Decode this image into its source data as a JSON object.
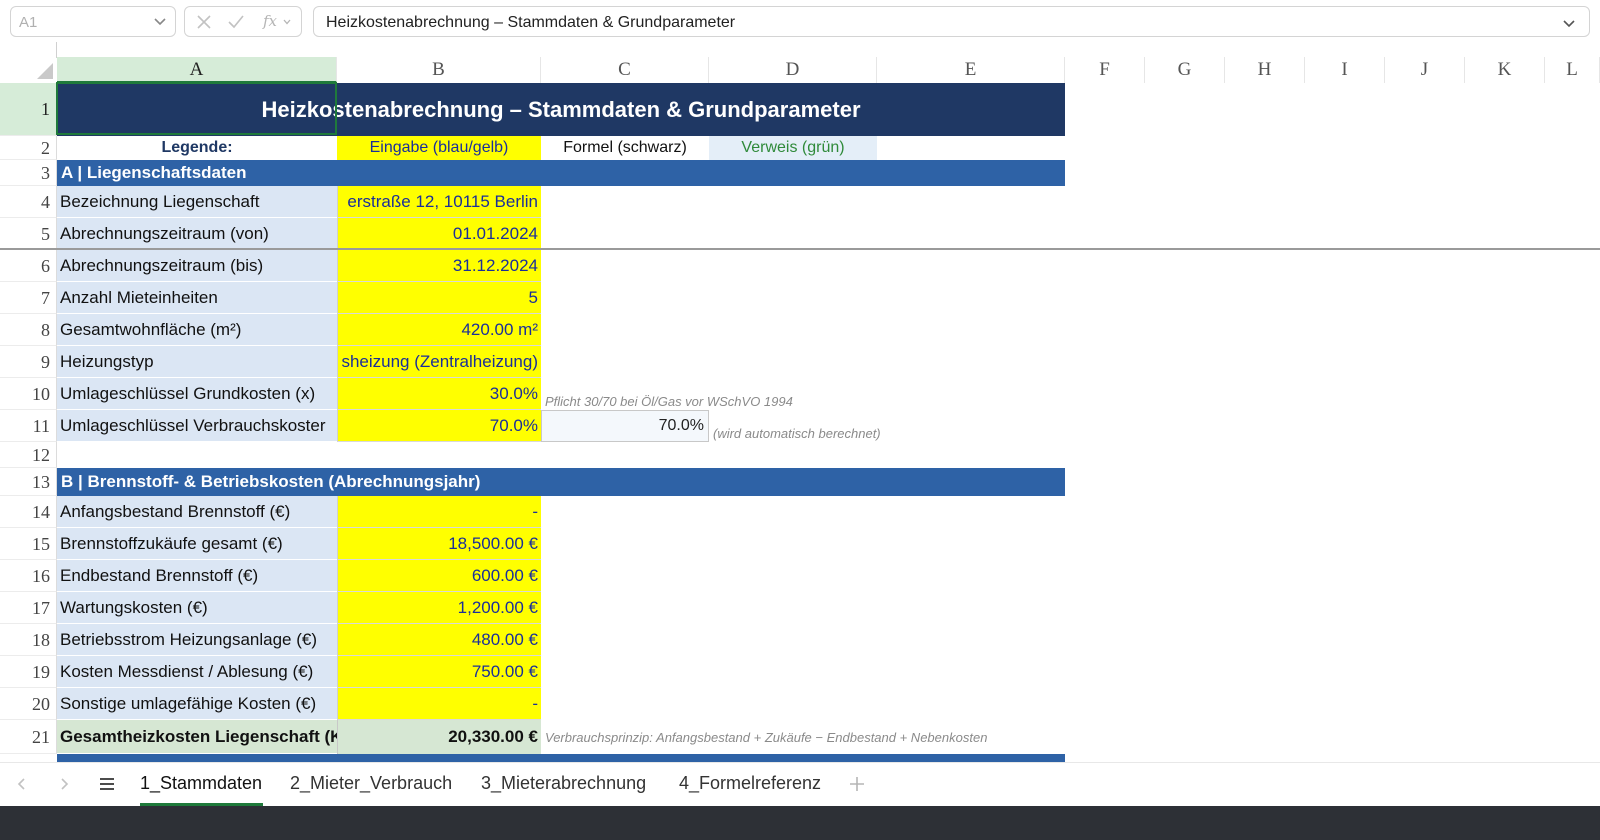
{
  "formula_bar": {
    "name_box": "A1",
    "fx_label": "fx",
    "formula_text": "Heizkostenabrechnung – Stammdaten & Grundparameter"
  },
  "columns": [
    "A",
    "B",
    "C",
    "D",
    "E",
    "F",
    "G",
    "H",
    "I",
    "J",
    "K",
    "L"
  ],
  "rows": [
    "1",
    "2",
    "3",
    "4",
    "5",
    "6",
    "7",
    "8",
    "9",
    "10",
    "11",
    "12",
    "13",
    "14",
    "15",
    "16",
    "17",
    "18",
    "19",
    "20",
    "21"
  ],
  "sheet": {
    "title": "Heizkostenabrechnung – Stammdaten & Grundparameter",
    "legend": {
      "label": "Legende:",
      "input": "Eingabe (blau/gelb)",
      "formula": "Formel (schwarz)",
      "reference": "Verweis (grün)"
    },
    "section_a": "A  |  Liegenschaftsdaten",
    "section_b": "B  |  Brennstoff- & Betriebskosten  (Abrechnungsjahr)",
    "rows_a": [
      {
        "label": "Bezeichnung Liegenschaft",
        "value": "erstraße 12, 10115 Berlin"
      },
      {
        "label": "Abrechnungszeitraum (von)",
        "value": "01.01.2024"
      },
      {
        "label": "Abrechnungszeitraum (bis)",
        "value": "31.12.2024"
      },
      {
        "label": "Anzahl Mieteinheiten",
        "value": "5"
      },
      {
        "label": "Gesamtwohnfläche (m²)",
        "value": "420.00 m²"
      },
      {
        "label": "Heizungstyp",
        "value": "sheizung (Zentralheizung)"
      },
      {
        "label": "Umlageschlüssel Grundkosten (x)",
        "value": "30.0%",
        "note": "Pflicht 30/70 bei Öl/Gas vor WSchVO 1994"
      },
      {
        "label": "Umlageschlüssel Verbrauchskoster",
        "value": "70.0%",
        "calc": "70.0%",
        "note": "(wird automatisch berechnet)"
      }
    ],
    "rows_b": [
      {
        "label": "Anfangsbestand Brennstoff (€)",
        "value": "-"
      },
      {
        "label": "Brennstoffzukäufe gesamt (€)",
        "value": "18,500.00 €"
      },
      {
        "label": "Endbestand Brennstoff (€)",
        "value": "600.00 €"
      },
      {
        "label": "Wartungskosten (€)",
        "value": "1,200.00 €"
      },
      {
        "label": "Betriebsstrom Heizungsanlage (€)",
        "value": "480.00 €"
      },
      {
        "label": "Kosten Messdienst / Ablesung (€)",
        "value": "750.00 €"
      },
      {
        "label": "Sonstige umlagefähige Kosten (€)",
        "value": "-"
      }
    ],
    "total": {
      "label": "Gesamtheizkosten Liegenschaft (K",
      "value": "20,330.00 €",
      "note": "Verbrauchsprinzip: Anfangsbestand + Zukäufe − Endbestand + Nebenkosten"
    }
  },
  "tabs": [
    "1_Stammdaten",
    "2_Mieter_Verbrauch",
    "3_Mieterabrechnung",
    "4_Formelreferenz"
  ],
  "active_tab": "1_Stammdaten",
  "colors": {
    "title": "#1f3864",
    "section": "#2e62a6",
    "input": "#ffff00",
    "label": "#dbe6f4",
    "total": "#d6e7d3",
    "selection": "#1f7a3b"
  }
}
